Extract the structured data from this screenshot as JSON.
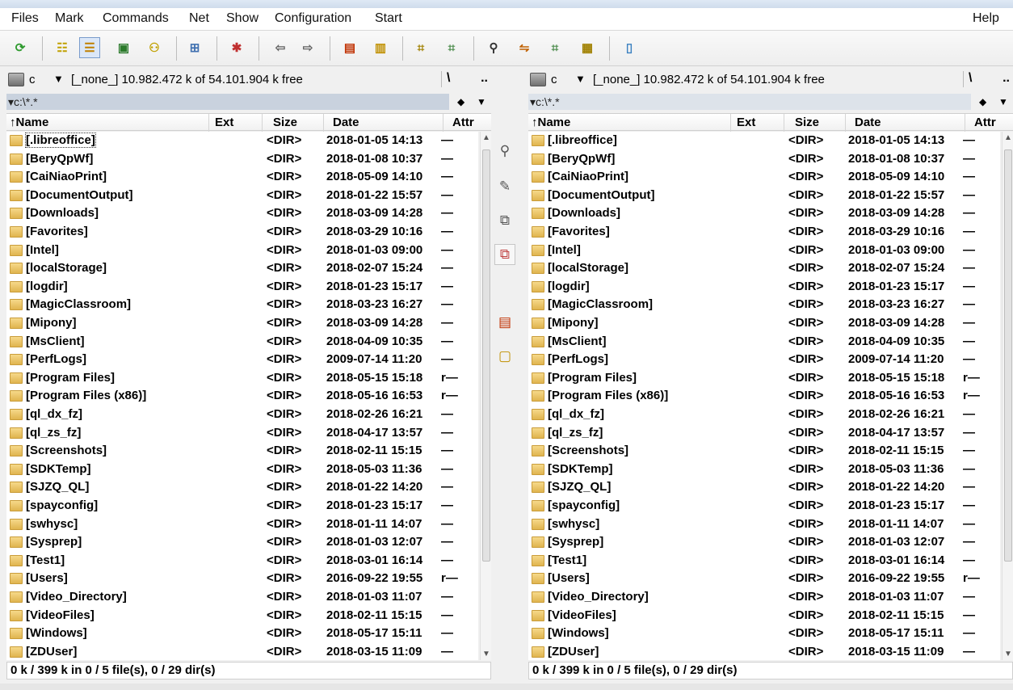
{
  "menu": [
    "Files",
    "Mark",
    "Commands",
    "Net",
    "Show",
    "Configuration",
    "Start"
  ],
  "help": "Help",
  "toolbar_icons": [
    "refresh-icon",
    "brief-view-icon",
    "full-view-icon",
    "thumbnails-icon",
    "tree-icon",
    "compare-dirs-icon",
    "multi-rename-icon",
    "back-icon",
    "forward-icon",
    "pack-icon",
    "unpack-icon",
    "ftp-connect-icon",
    "ftp-new-icon",
    "search-icon",
    "sync-dirs-icon",
    "dir-hotlist-icon",
    "copy-names-icon",
    "notepad-icon"
  ],
  "left": {
    "drive": "c",
    "free": "[_none_]  10.982.472 k of 54.101.904 k free",
    "root": "\\",
    "up": "..",
    "path": "▾c:\\*.*",
    "headers": {
      "name": "↑Name",
      "ext": "Ext",
      "size": "Size",
      "date": "Date",
      "attr": "Attr"
    },
    "status": "0 k / 399 k in 0 / 5 file(s), 0 / 29 dir(s)"
  },
  "right": {
    "drive": "c",
    "free": "[_none_]  10.982.472 k of 54.101.904 k free",
    "root": "\\",
    "up": "..",
    "path": "▾c:\\*.*",
    "headers": {
      "name": "↑Name",
      "ext": "Ext",
      "size": "Size",
      "date": "Date",
      "attr": "Attr"
    },
    "status": "0 k / 399 k in 0 / 5 file(s), 0 / 29 dir(s)"
  },
  "files": [
    {
      "name": "[.libreoffice]",
      "size": "<DIR>",
      "date": "2018-01-05 14:13",
      "attr": "—"
    },
    {
      "name": "[BeryQpWf]",
      "size": "<DIR>",
      "date": "2018-01-08 10:37",
      "attr": "—"
    },
    {
      "name": "[CaiNiaoPrint]",
      "size": "<DIR>",
      "date": "2018-05-09 14:10",
      "attr": "—"
    },
    {
      "name": "[DocumentOutput]",
      "size": "<DIR>",
      "date": "2018-01-22 15:57",
      "attr": "—"
    },
    {
      "name": "[Downloads]",
      "size": "<DIR>",
      "date": "2018-03-09 14:28",
      "attr": "—"
    },
    {
      "name": "[Favorites]",
      "size": "<DIR>",
      "date": "2018-03-29 10:16",
      "attr": "—"
    },
    {
      "name": "[Intel]",
      "size": "<DIR>",
      "date": "2018-01-03 09:00",
      "attr": "—"
    },
    {
      "name": "[localStorage]",
      "size": "<DIR>",
      "date": "2018-02-07 15:24",
      "attr": "—"
    },
    {
      "name": "[logdir]",
      "size": "<DIR>",
      "date": "2018-01-23 15:17",
      "attr": "—"
    },
    {
      "name": "[MagicClassroom]",
      "size": "<DIR>",
      "date": "2018-03-23 16:27",
      "attr": "—"
    },
    {
      "name": "[Mipony]",
      "size": "<DIR>",
      "date": "2018-03-09 14:28",
      "attr": "—"
    },
    {
      "name": "[MsClient]",
      "size": "<DIR>",
      "date": "2018-04-09 10:35",
      "attr": "—"
    },
    {
      "name": "[PerfLogs]",
      "size": "<DIR>",
      "date": "2009-07-14 11:20",
      "attr": "—"
    },
    {
      "name": "[Program Files]",
      "size": "<DIR>",
      "date": "2018-05-15 15:18",
      "attr": "r—"
    },
    {
      "name": "[Program Files (x86)]",
      "size": "<DIR>",
      "date": "2018-05-16 16:53",
      "attr": "r—"
    },
    {
      "name": "[ql_dx_fz]",
      "size": "<DIR>",
      "date": "2018-02-26 16:21",
      "attr": "—"
    },
    {
      "name": "[ql_zs_fz]",
      "size": "<DIR>",
      "date": "2018-04-17 13:57",
      "attr": "—"
    },
    {
      "name": "[Screenshots]",
      "size": "<DIR>",
      "date": "2018-02-11 15:15",
      "attr": "—"
    },
    {
      "name": "[SDKTemp]",
      "size": "<DIR>",
      "date": "2018-05-03 11:36",
      "attr": "—"
    },
    {
      "name": "[SJZQ_QL]",
      "size": "<DIR>",
      "date": "2018-01-22 14:20",
      "attr": "—"
    },
    {
      "name": "[spayconfig]",
      "size": "<DIR>",
      "date": "2018-01-23 15:17",
      "attr": "—"
    },
    {
      "name": "[swhysc]",
      "size": "<DIR>",
      "date": "2018-01-11 14:07",
      "attr": "—"
    },
    {
      "name": "[Sysprep]",
      "size": "<DIR>",
      "date": "2018-01-03 12:07",
      "attr": "—"
    },
    {
      "name": "[Test1]",
      "size": "<DIR>",
      "date": "2018-03-01 16:14",
      "attr": "—"
    },
    {
      "name": "[Users]",
      "size": "<DIR>",
      "date": "2016-09-22 19:55",
      "attr": "r—"
    },
    {
      "name": "[Video_Directory]",
      "size": "<DIR>",
      "date": "2018-01-03 11:07",
      "attr": "—"
    },
    {
      "name": "[VideoFiles]",
      "size": "<DIR>",
      "date": "2018-02-11 15:15",
      "attr": "—"
    },
    {
      "name": "[Windows]",
      "size": "<DIR>",
      "date": "2018-05-17 15:11",
      "attr": "—"
    },
    {
      "name": "[ZDUser]",
      "size": "<DIR>",
      "date": "2018-03-15 11:09",
      "attr": "—"
    }
  ],
  "mid_buttons": [
    "view-icon",
    "edit-icon",
    "copy-icon",
    "move-icon",
    "pack-icon",
    "new-folder-icon"
  ]
}
